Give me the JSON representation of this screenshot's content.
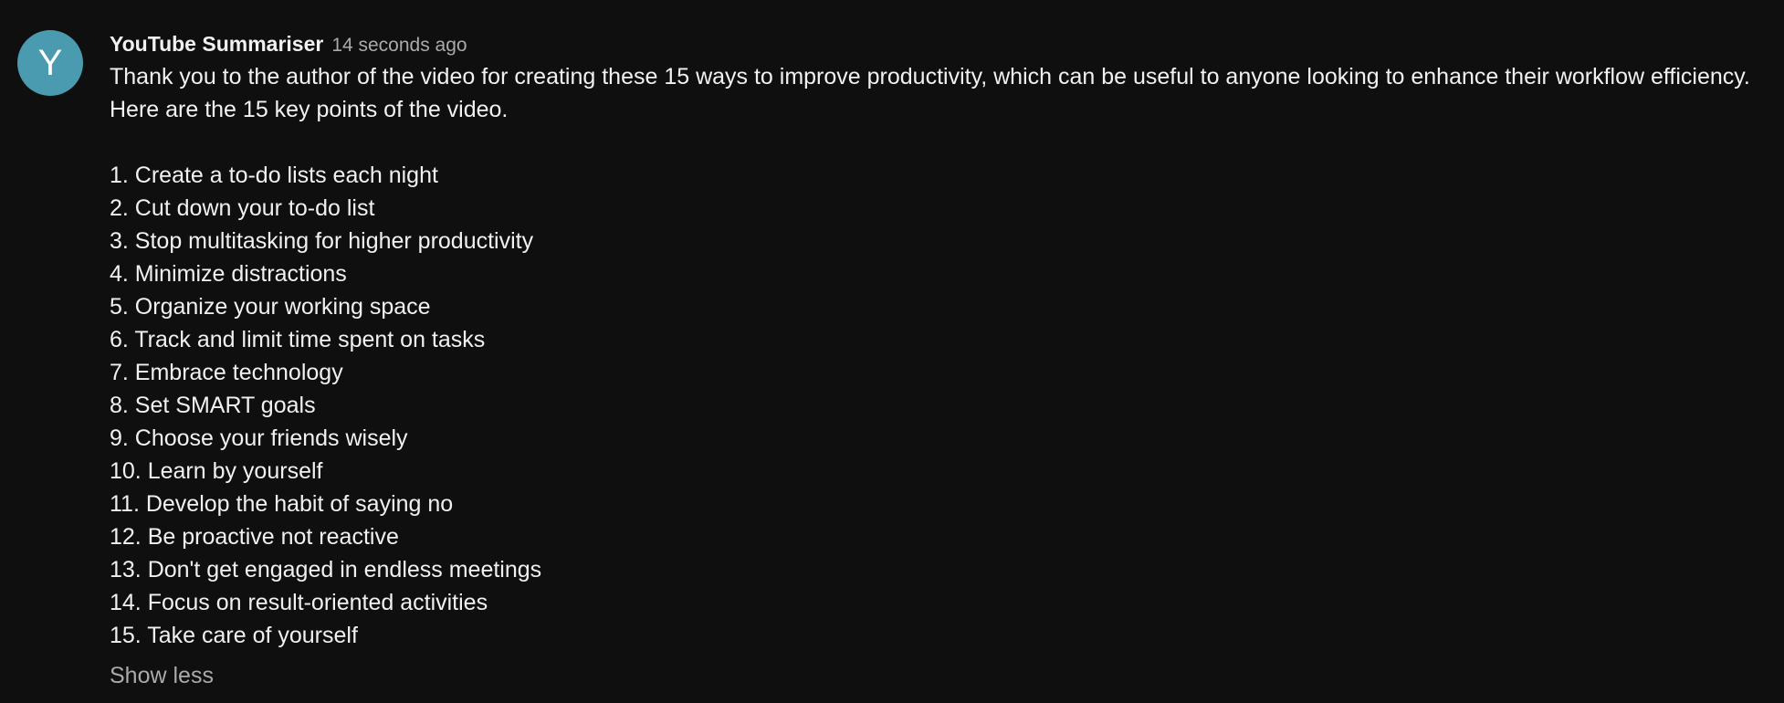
{
  "comment": {
    "avatar_letter": "Y",
    "avatar_color": "#4a9bb0",
    "author": "YouTube Summariser",
    "timestamp": "14 seconds ago",
    "intro_line1": "Thank you to the author of the video for creating these 15 ways to improve productivity, which can be useful to anyone looking to enhance their workflow efficiency.",
    "intro_line2": "Here are the 15 key points of the video.",
    "points": [
      "1. Create a to-do lists each night",
      "2. Cut down your to-do list",
      "3. Stop multitasking for higher productivity",
      "4. Minimize distractions",
      "5. Organize your working space",
      "6. Track and limit time spent on tasks",
      "7. Embrace technology",
      "8. Set SMART goals",
      "9. Choose your friends wisely",
      "10. Learn by yourself",
      "11. Develop the habit of saying no",
      "12. Be proactive not reactive",
      "13. Don't get engaged in endless meetings",
      "14. Focus on result-oriented activities",
      "15. Take care of yourself"
    ],
    "show_less_label": "Show less"
  }
}
